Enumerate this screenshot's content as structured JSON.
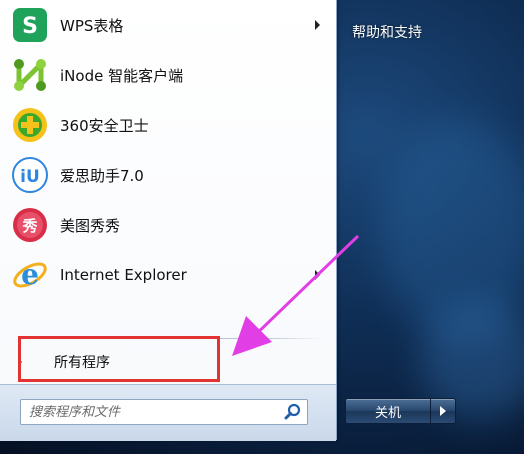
{
  "programs": [
    {
      "label": "WPS表格",
      "icon": "wps-spreadsheet-icon",
      "has_submenu": true
    },
    {
      "label": "iNode 智能客户端",
      "icon": "inode-client-icon",
      "has_submenu": false
    },
    {
      "label": "360安全卫士",
      "icon": "360-security-icon",
      "has_submenu": false
    },
    {
      "label": "爱思助手7.0",
      "icon": "i4-assistant-icon",
      "has_submenu": false
    },
    {
      "label": "美图秀秀",
      "icon": "meitu-icon",
      "has_submenu": false
    },
    {
      "label": "Internet Explorer",
      "icon": "internet-explorer-icon",
      "has_submenu": true
    }
  ],
  "all_programs": {
    "label": "所有程序"
  },
  "search": {
    "placeholder": "搜索程序和文件"
  },
  "right_panel": {
    "help_label": "帮助和支持"
  },
  "shutdown": {
    "label": "关机"
  },
  "icons": {
    "wps_text": "S",
    "i4_text": "iU",
    "meitu_text": "秀",
    "ie_text": "e"
  },
  "colors": {
    "highlight_box": "#e33232",
    "annotation_arrow": "#e23ee6",
    "desktop": "#0f2e55"
  }
}
